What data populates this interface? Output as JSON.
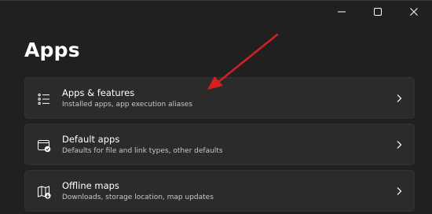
{
  "window": {
    "controls": [
      {
        "name": "minimize-button",
        "icon": "minimize-icon"
      },
      {
        "name": "maximize-button",
        "icon": "maximize-icon"
      },
      {
        "name": "close-button",
        "icon": "close-icon"
      }
    ]
  },
  "page": {
    "title": "Apps"
  },
  "cards": [
    {
      "title": "Apps & features",
      "description": "Installed apps, app execution aliases",
      "icon": "apps-list-icon"
    },
    {
      "title": "Default apps",
      "description": "Defaults for file and link types, other defaults",
      "icon": "default-apps-icon"
    },
    {
      "title": "Offline maps",
      "description": "Downloads, storage location, map updates",
      "icon": "offline-maps-icon"
    }
  ],
  "annotation": {
    "arrow_color": "#d42020"
  },
  "colors": {
    "background": "#202020",
    "card": "#2b2b2b",
    "text_primary": "#ffffff",
    "text_secondary": "#c8c8c8"
  }
}
